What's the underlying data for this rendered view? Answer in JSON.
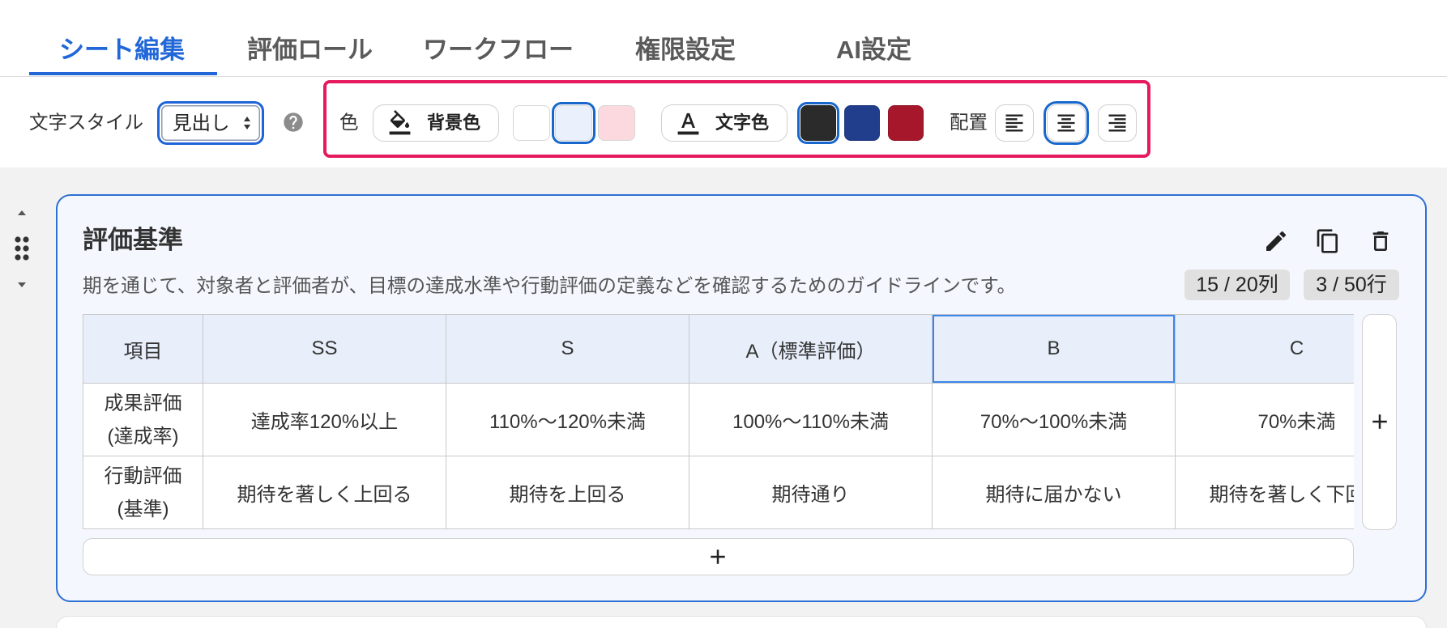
{
  "tabs": [
    {
      "label": "シート編集",
      "active": true
    },
    {
      "label": "評価ロール",
      "active": false
    },
    {
      "label": "ワークフロー",
      "active": false
    },
    {
      "label": "権限設定",
      "active": false
    },
    {
      "label": "AI設定",
      "active": false
    }
  ],
  "toolbar": {
    "text_style_label": "文字スタイル",
    "text_style_value": "見出し",
    "help_icon": "help-circle-icon",
    "color_label": "色",
    "bg_color_button": {
      "label": "背景色",
      "icon": "paint-bucket-icon"
    },
    "bg_colors": [
      {
        "color": "#ffffff",
        "selected": false
      },
      {
        "color": "#eaf1fc",
        "selected": true
      },
      {
        "color": "#fbd9df",
        "selected": false
      }
    ],
    "text_color_button": {
      "label": "文字色",
      "icon": "text-color-icon"
    },
    "text_colors": [
      {
        "color": "#2b2b2b",
        "selected": true
      },
      {
        "color": "#213e8c",
        "selected": false
      },
      {
        "color": "#a7172b",
        "selected": false
      }
    ],
    "align_label": "配置",
    "align_options": [
      {
        "icon": "align-left-icon",
        "selected": false
      },
      {
        "icon": "align-center-icon",
        "selected": true
      },
      {
        "icon": "align-right-icon",
        "selected": false
      }
    ]
  },
  "side_controls": {
    "move_up_icon": "triangle-up-icon",
    "drag_icon": "drag-handle-icon",
    "move_down_icon": "triangle-down-icon"
  },
  "sheet": {
    "title": "評価基準",
    "action_icons": [
      "edit-icon",
      "copy-icon",
      "delete-icon"
    ],
    "description": "期を通じて、対象者と評価者が、目標の達成水準や行動評価の定義などを確認するためのガイドラインです。",
    "columns_badge": "15 / 20列",
    "rows_badge": "3 / 50行",
    "table": {
      "headers": [
        {
          "label": "項目",
          "selected": false
        },
        {
          "label": "SS",
          "selected": false
        },
        {
          "label": "S",
          "selected": false
        },
        {
          "label": "A（標準評価）",
          "selected": false
        },
        {
          "label": "B",
          "selected": true
        },
        {
          "label": "C",
          "selected": false
        }
      ],
      "rows": [
        {
          "label": [
            "成果評価",
            "(達成率)"
          ],
          "cells": [
            "達成率120%以上",
            "110%〜120%未満",
            "100%〜110%未満",
            "70%〜100%未満",
            "70%未満"
          ]
        },
        {
          "label": [
            "行動評価",
            "(基準)"
          ],
          "cells": [
            "期待を著しく上回る",
            "期待を上回る",
            "期待通り",
            "期待に届かない",
            "期待を著しく下回"
          ]
        }
      ]
    },
    "add_column_icon": "plus-icon",
    "add_row_icon": "plus-icon"
  },
  "colors": {
    "accent": "#2167d8",
    "highlight_frame": "#e5195e",
    "card_border": "#2d6fd3",
    "header_bg": "#e8effb",
    "workarea_bg": "#f3f2f3"
  }
}
